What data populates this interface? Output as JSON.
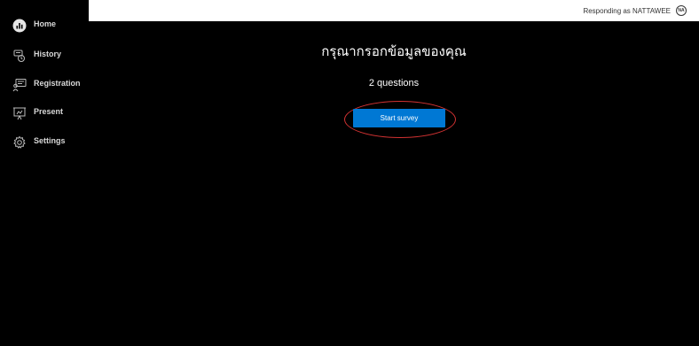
{
  "sidebar": {
    "items": [
      {
        "label": "Home",
        "icon": "home-icon"
      },
      {
        "label": "History",
        "icon": "history-icon"
      },
      {
        "label": "Registration",
        "icon": "registration-icon"
      },
      {
        "label": "Present",
        "icon": "present-icon"
      },
      {
        "label": "Settings",
        "icon": "settings-icon"
      }
    ]
  },
  "header": {
    "responding_text": "Responding as NATTAWEE",
    "avatar_initials": "NA"
  },
  "survey": {
    "title": "กรุณากรอกข้อมูลของคุณ",
    "question_count": "2 questions",
    "start_label": "Start survey"
  },
  "colors": {
    "accent": "#0078d4",
    "highlight": "#d23232",
    "background": "#000000"
  }
}
